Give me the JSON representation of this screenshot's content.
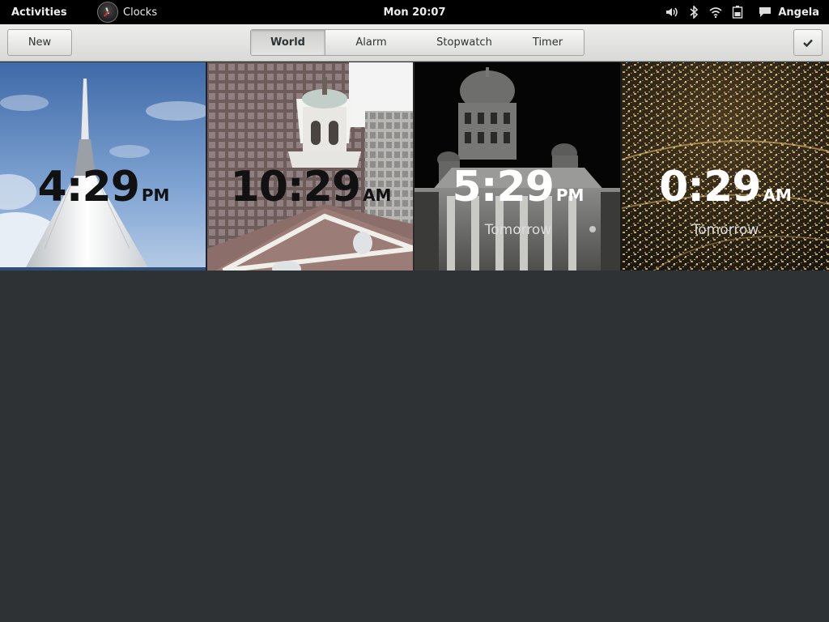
{
  "topbar": {
    "activities": "Activities",
    "app_name": "Clocks",
    "datetime": "Mon 20:07",
    "user": "Angela",
    "status_icons": [
      "volume-icon",
      "bluetooth-icon",
      "wifi-icon",
      "battery-icon",
      "chat-icon"
    ]
  },
  "toolbar": {
    "new_label": "New",
    "done_icon": "checkmark-icon",
    "tabs": [
      {
        "label": "World",
        "selected": true
      },
      {
        "label": "Alarm",
        "selected": false
      },
      {
        "label": "Stopwatch",
        "selected": false
      },
      {
        "label": "Timer",
        "selected": false
      }
    ]
  },
  "clocks": [
    {
      "time": "4:29",
      "ampm": "PM",
      "day": ""
    },
    {
      "time": "10:29",
      "ampm": "AM",
      "day": ""
    },
    {
      "time": "5:29",
      "ampm": "PM",
      "day": "Tomorrow"
    },
    {
      "time": "0:29",
      "ampm": "AM",
      "day": "Tomorrow"
    }
  ],
  "colors": {
    "topbar_bg": "#000000",
    "content_bg": "#2e3235",
    "toolbar_bg": "#e4e5e2"
  }
}
